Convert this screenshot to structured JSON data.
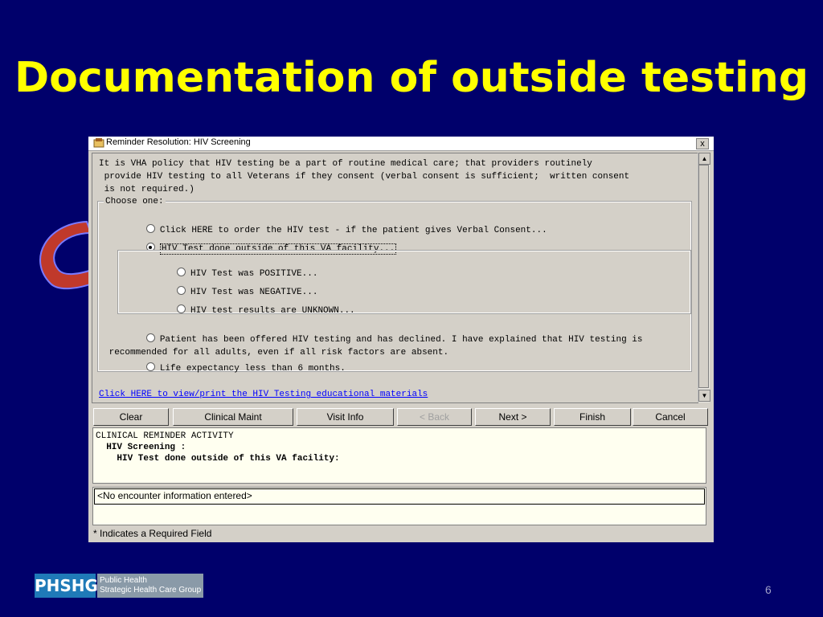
{
  "slide": {
    "title": "Documentation of outside testing",
    "page_number": "6",
    "logo_abbrev": "PHSHG",
    "logo_line1": "Public Health",
    "logo_line2": "Strategic Health Care Group"
  },
  "window": {
    "title": "Reminder Resolution: HIV Screening",
    "close_label": "x"
  },
  "dialog": {
    "policy_text": "It is VHA policy that HIV testing be a part of routine medical care; that providers routinely\n provide HIV testing to all Veterans if they consent (verbal consent is sufficient;  written consent\n is not required.)",
    "group_label": "Choose one:",
    "options": [
      {
        "label": "Click HERE to order the HIV test - if the patient gives Verbal Consent...",
        "checked": false
      },
      {
        "label": "HIV Test done outside of this VA facility...",
        "checked": true
      },
      {
        "label": "Patient has been offered HIV testing and has declined. I have explained that HIV testing is\n recommended for all adults, even if all risk factors are absent.",
        "checked": false
      },
      {
        "label": "Life expectancy less than 6 months.",
        "checked": false
      }
    ],
    "sub_options": [
      {
        "label": "HIV Test was POSITIVE...",
        "checked": false
      },
      {
        "label": "HIV Test was NEGATIVE...",
        "checked": false
      },
      {
        "label": "HIV test results are UNKNOWN...",
        "checked": false
      }
    ],
    "edu_link": "Click HERE to view/print the HIV Testing educational materials"
  },
  "buttons": {
    "clear": "Clear",
    "clinical_maint": "Clinical Maint",
    "visit_info": "Visit Info",
    "back": "< Back",
    "next": "Next >",
    "finish": "Finish",
    "cancel": "Cancel"
  },
  "activity": {
    "line1": "CLINICAL REMINDER ACTIVITY",
    "line2": "  HIV Screening :",
    "line3": "    HIV Test done outside of this VA facility:"
  },
  "encounter": {
    "text": "<No encounter information entered>"
  },
  "footer": {
    "required_note": "* Indicates a Required Field"
  },
  "colors": {
    "background": "#00006b",
    "title": "#ffff00",
    "link": "#0000ff",
    "arrow": "#c0392b"
  }
}
